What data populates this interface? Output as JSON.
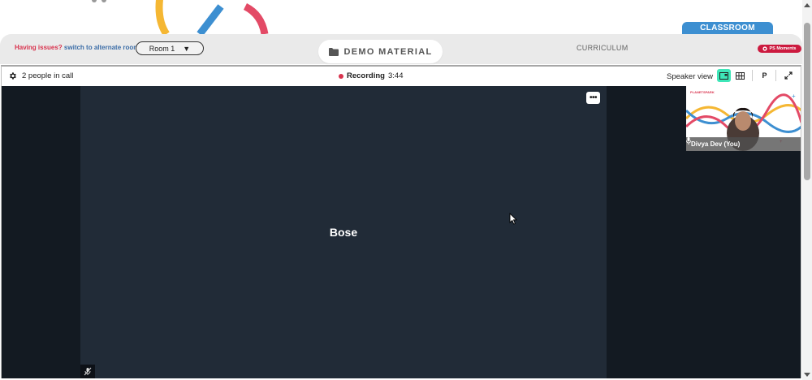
{
  "brand": {
    "classroom_tab": "CLASSROOM",
    "accent_red": "#d9334e",
    "accent_blue": "#3d8fd1",
    "accent_yellow": "#f5b733"
  },
  "toolbar": {
    "issues_label": "Having issues?",
    "switch_link": "switch to alternate room",
    "room_value": "Room 1",
    "demo_material_label": "DEMO MATERIAL",
    "curriculum_label": "CURRICULUM",
    "moments_label": "PS Moments"
  },
  "call": {
    "people_count": "2 people in call",
    "recording_label": "Recording",
    "recording_time": "3:44",
    "speaker_view_label": "Speaker view",
    "p_button": "P",
    "active_view_color": "#3ee6b8",
    "main_participant": "Bose",
    "more_options": "•••",
    "self_participant": "Divya Dev (You)",
    "self_brand": "PLANETSPARK"
  }
}
